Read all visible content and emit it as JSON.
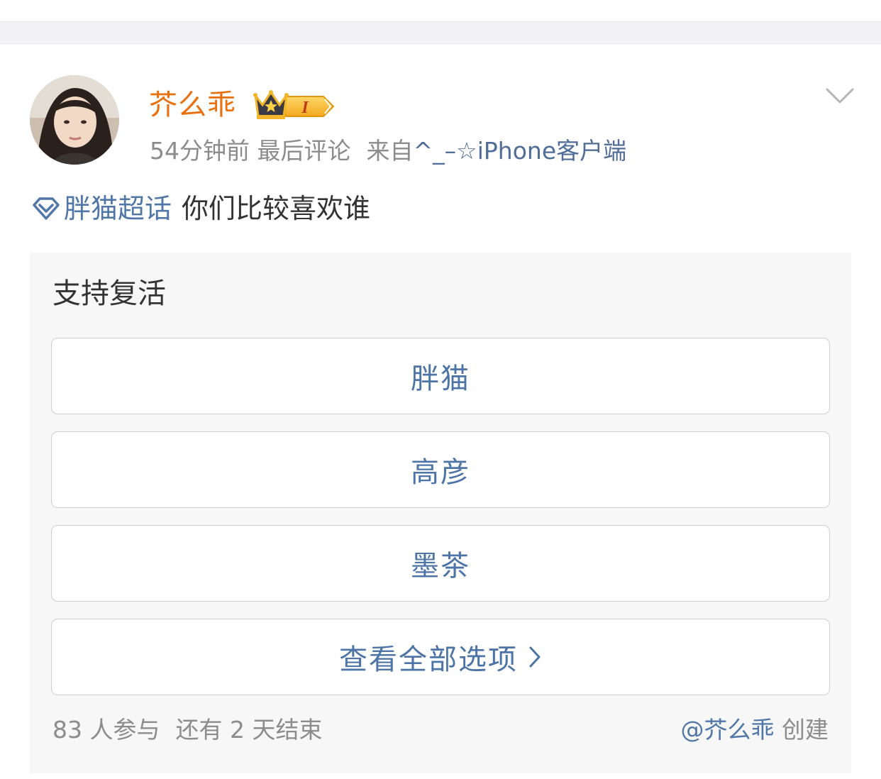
{
  "post": {
    "username": "芥么乖",
    "vip_badge_level": "I",
    "time": "54分钟前",
    "last_comment": "最后评论",
    "source_prefix": "来自",
    "source": "^_–☆iPhone客户端",
    "topic": "胖猫超话",
    "text": "你们比较喜欢谁"
  },
  "poll": {
    "title": "支持复活",
    "options": [
      "胖猫",
      "高彦",
      "墨茶"
    ],
    "view_all_label": "查看全部选项",
    "participants": "83 人参与",
    "remaining": "还有 2 天结束",
    "creator": "@芥么乖",
    "created_label": "创建"
  },
  "colors": {
    "username": "#e9700f",
    "link": "#5077a8",
    "muted": "#8c8c8c",
    "body_text": "#333333",
    "card_bg": "#f7f7f7",
    "separator_band": "#f2f2f4"
  }
}
